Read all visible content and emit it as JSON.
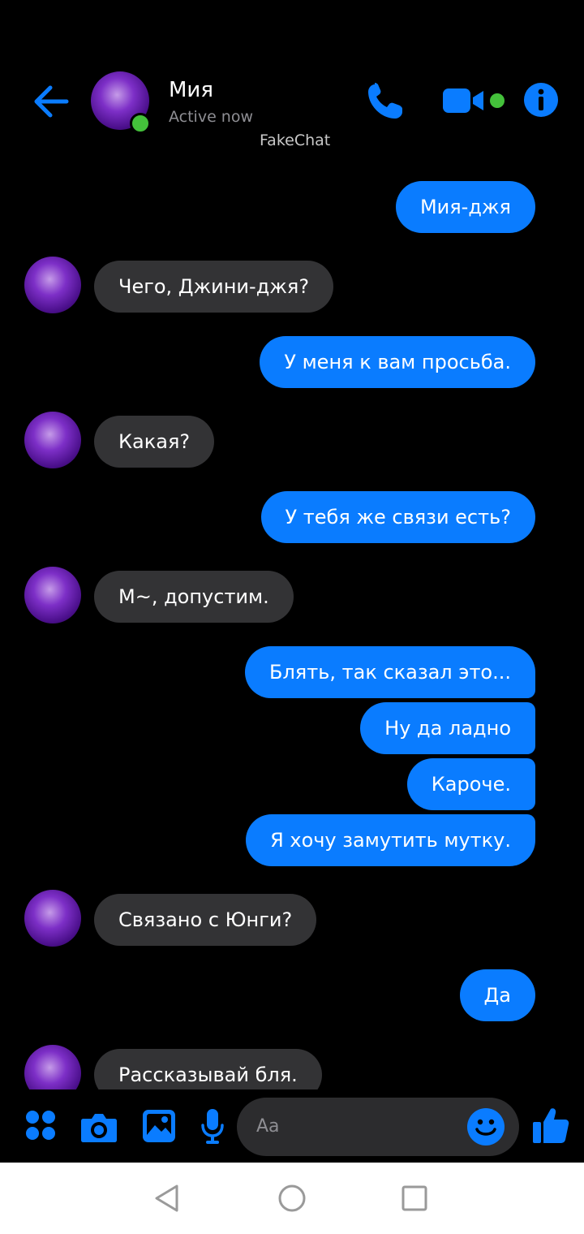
{
  "header": {
    "contact_name": "Мия",
    "status": "Active now",
    "watermark": "FakeChat"
  },
  "messages": [
    {
      "dir": "out",
      "text": "Мия-джя"
    },
    {
      "dir": "in",
      "text": "Чего, Джини-джя?"
    },
    {
      "dir": "out",
      "text": "У меня к вам просьба."
    },
    {
      "dir": "in",
      "text": "Какая?"
    },
    {
      "dir": "out",
      "text": "У тебя же связи есть?"
    },
    {
      "dir": "in",
      "text": "М~, допустим."
    },
    {
      "dir": "out",
      "text": "Блять, так сказал это..."
    },
    {
      "dir": "out",
      "text": "Ну да ладно"
    },
    {
      "dir": "out",
      "text": "Кароче."
    },
    {
      "dir": "out",
      "text": "Я хочу замутить мутку."
    },
    {
      "dir": "in",
      "text": "Связано с Юнги?"
    },
    {
      "dir": "out",
      "text": "Да"
    },
    {
      "dir": "in",
      "text": "Рассказывай бля."
    }
  ],
  "composer": {
    "placeholder": "Aa"
  },
  "colors": {
    "accent": "#0a7cff",
    "incoming_bubble": "#333335",
    "online": "#44c13b",
    "icon_blue": "#0a7cff"
  },
  "icons": [
    "back-arrow-icon",
    "phone-icon",
    "video-camera-icon",
    "info-icon",
    "apps-icon",
    "camera-icon",
    "gallery-icon",
    "microphone-icon",
    "emoji-icon",
    "thumbs-up-icon",
    "nav-back-icon",
    "nav-home-icon",
    "nav-recents-icon"
  ]
}
